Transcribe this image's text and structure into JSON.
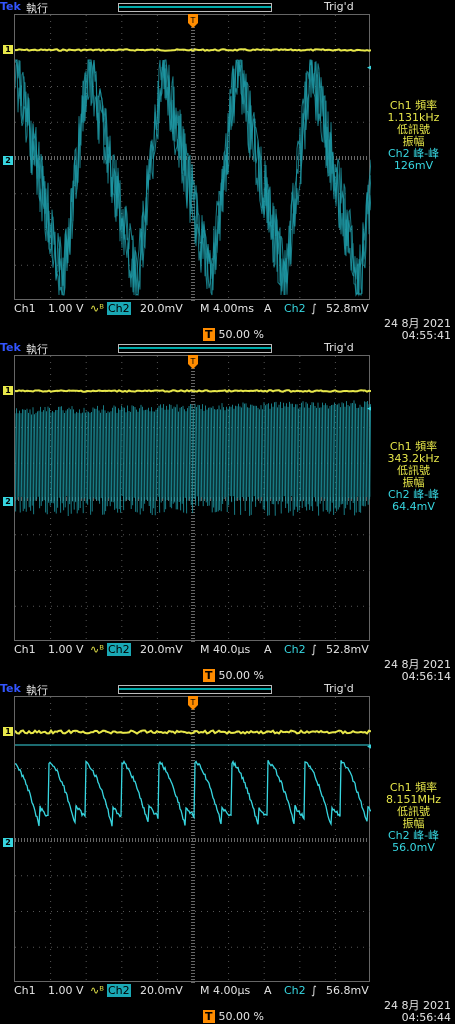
{
  "panels": [
    {
      "brand": "Tek",
      "run_state": "執行",
      "trig_state": "Trig'd",
      "ch1_marker": "1",
      "ch2_marker": "2",
      "side": {
        "l1": "Ch1 頻率",
        "l2": "1.131kHz",
        "l3": "低訊號",
        "l4": "振幅",
        "l5": "Ch2 峰-峰",
        "l6": "126mV"
      },
      "bottom": {
        "ch1": "Ch1",
        "ch1_scale": "1.00 V",
        "ch2": "Ch2",
        "ch2_scale": "20.0mV",
        "timebase": "M 4.00ms",
        "trig_mode": "A",
        "trig_src": "Ch2",
        "trig_slope": "∫",
        "trig_level": "52.8mV"
      },
      "date": "24 8月  2021",
      "time": "04:55:41",
      "position_pct": "50.00 %",
      "wave": "triangle-noisy"
    },
    {
      "brand": "Tek",
      "run_state": "執行",
      "trig_state": "Trig'd",
      "ch1_marker": "1",
      "ch2_marker": "2",
      "side": {
        "l1": "Ch1 頻率",
        "l2": "343.2kHz",
        "l3": "低訊號",
        "l4": "振幅",
        "l5": "Ch2 峰-峰",
        "l6": "64.4mV"
      },
      "bottom": {
        "ch1": "Ch1",
        "ch1_scale": "1.00 V",
        "ch2": "Ch2",
        "ch2_scale": "20.0mV",
        "timebase": "M 40.0µs",
        "trig_mode": "A",
        "trig_src": "Ch2",
        "trig_slope": "∫",
        "trig_level": "52.8mV"
      },
      "date": "24 8月  2021",
      "time": "04:56:14",
      "position_pct": "50.00 %",
      "wave": "dense"
    },
    {
      "brand": "Tek",
      "run_state": "執行",
      "trig_state": "Trig'd",
      "ch1_marker": "1",
      "ch2_marker": "2",
      "side": {
        "l1": "Ch1 頻率",
        "l2": "8.151MHz",
        "l3": "低訊號",
        "l4": "振幅",
        "l5": "Ch2 峰-峰",
        "l6": "56.0mV"
      },
      "bottom": {
        "ch1": "Ch1",
        "ch1_scale": "1.00 V",
        "ch2": "Ch2",
        "ch2_scale": "20.0mV",
        "timebase": "M 4.00µs",
        "trig_mode": "A",
        "trig_src": "Ch2",
        "trig_slope": "∫",
        "trig_level": "56.8mV"
      },
      "date": "24 8月  2021",
      "time": "04:56:44",
      "position_pct": "50.00 %",
      "wave": "scallop"
    }
  ],
  "colors": {
    "ch1": "#e8e84a",
    "ch2": "#37d6e0",
    "trigger": "#ff8c00",
    "brand": "#3355ff"
  }
}
